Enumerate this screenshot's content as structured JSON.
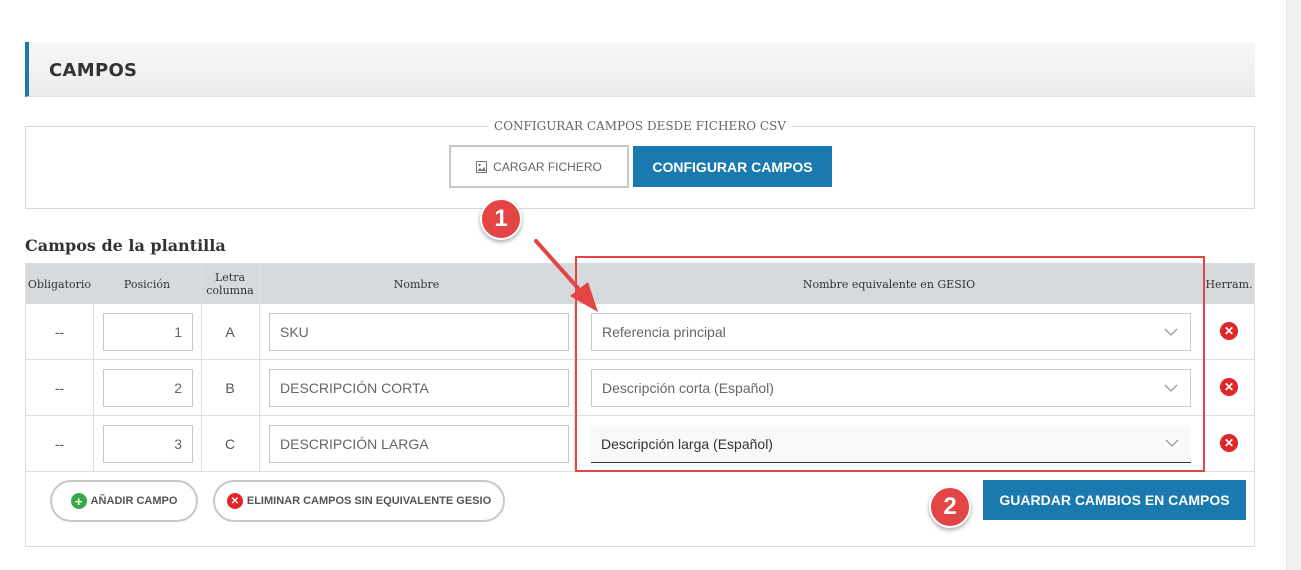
{
  "section": {
    "title": "CAMPOS"
  },
  "csv": {
    "legend": "CONFIGURAR CAMPOS DESDE FICHERO CSV",
    "upload_label": "CARGAR FICHERO",
    "upload_icon": "image-file-icon",
    "configure_label": "CONFIGURAR CAMPOS"
  },
  "template": {
    "title": "Campos de la plantilla",
    "headers": {
      "mandatory": "Obligatorio",
      "position": "Posición",
      "letter_line1": "Letra",
      "letter_line2": "columna",
      "name": "Nombre",
      "gesio": "Nombre equivalente en GESIO",
      "tools": "Herram."
    },
    "rows": [
      {
        "mandatory": "--",
        "position": "1",
        "letter": "A",
        "name": "SKU",
        "gesio": "Referencia principal"
      },
      {
        "mandatory": "--",
        "position": "2",
        "letter": "B",
        "name": "DESCRIPCIÓN CORTA",
        "gesio": "Descripción corta (Español)"
      },
      {
        "mandatory": "--",
        "position": "3",
        "letter": "C",
        "name": "DESCRIPCIÓN LARGA",
        "gesio": "Descripción larga (Español)"
      }
    ],
    "add_label": "AÑADIR CAMPO",
    "remove_label": "ELIMINAR CAMPOS SIN EQUIVALENTE GESIO",
    "save_label": "GUARDAR CAMBIOS EN CAMPOS"
  },
  "annotations": {
    "step1": "1",
    "step2": "2"
  },
  "colors": {
    "primary": "#1a7ab0",
    "danger": "#e0262a",
    "annotation": "#e34444",
    "add": "#3aa84a",
    "header_bg": "#d6dadd"
  }
}
